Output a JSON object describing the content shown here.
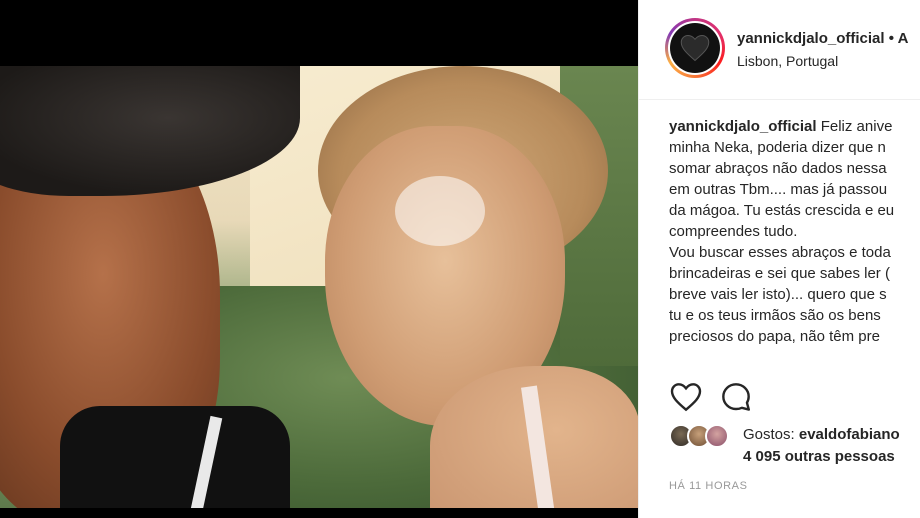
{
  "post": {
    "username": "yannickdjalo_official",
    "header_suffix": " • A",
    "location": "Lisbon, Portugal",
    "caption_lines": [
      "Feliz anive",
      "minha Neka, poderia dizer que n",
      "somar abraços não dados nessa",
      "em outras Tbm.... mas já passou",
      "da mágoa. Tu estás crescida e eu",
      "compreendes tudo.",
      "Vou buscar esses abraços e toda",
      "brincadeiras e sei que sabes ler (",
      "breve vais ler isto)... quero que s",
      "tu e os teus irmãos são os bens",
      "preciosos do papa, não têm pre"
    ],
    "likes_prefix": "Gostos: ",
    "liker": "evaldofabiano",
    "likes_others": "4 095 outras pessoas",
    "timestamp": "HÁ 11 HORAS"
  },
  "icons": {
    "avatar": "black-heart-icon",
    "like": "heart-outline-icon",
    "comment": "comment-bubble-icon"
  },
  "colors": {
    "ring_start": "#c13584",
    "ring_end": "#fcaf45",
    "text": "#262626",
    "muted": "#999999"
  }
}
